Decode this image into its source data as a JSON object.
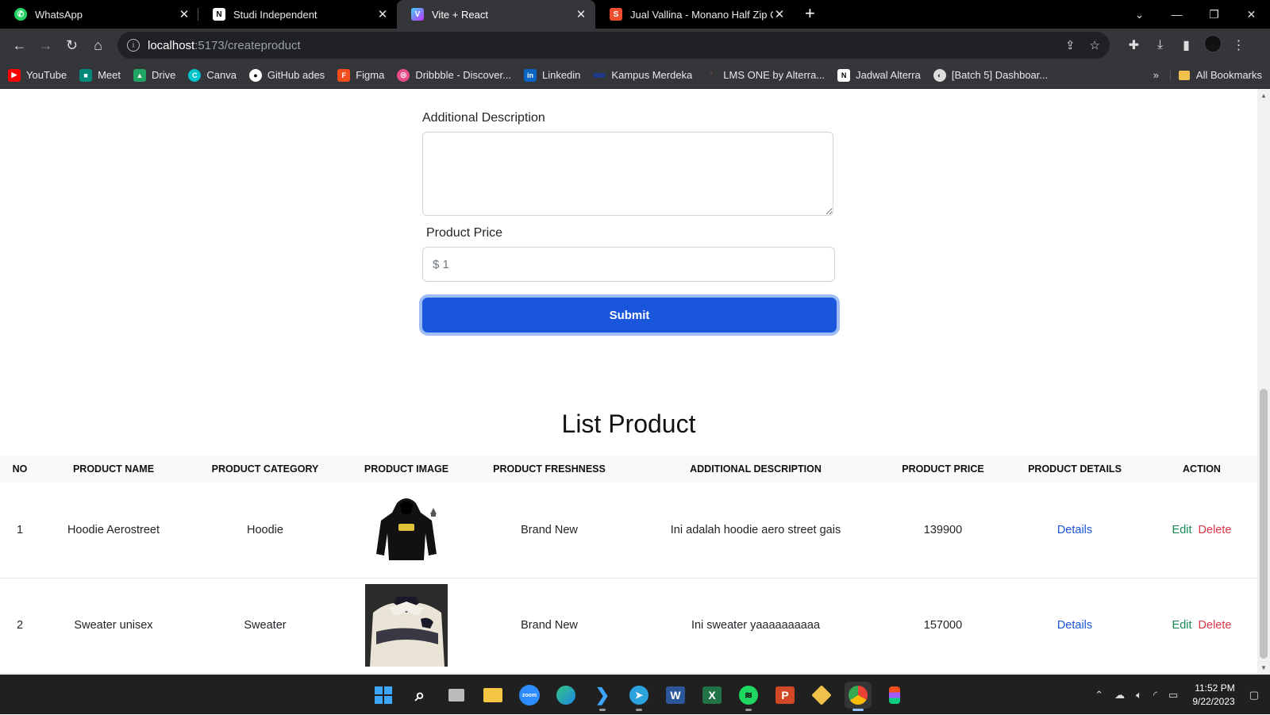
{
  "tabs": [
    {
      "title": "WhatsApp",
      "icon": "whatsapp-icon",
      "color": "#25d366",
      "active": false
    },
    {
      "title": "Studi Independent",
      "icon": "notion-icon",
      "color": "#ffffff",
      "active": false
    },
    {
      "title": "Vite + React",
      "icon": "vite-icon",
      "color": "#a259ff",
      "active": true
    },
    {
      "title": "Jual Vallina - Monano Half Zip C",
      "icon": "shopee-icon",
      "color": "#ee4d2d",
      "active": false
    }
  ],
  "address": {
    "host": "localhost",
    "path": ":5173/createproduct"
  },
  "bookmarks": [
    {
      "label": "YouTube",
      "icon": "youtube-icon",
      "color": "#ff0000"
    },
    {
      "label": "Meet",
      "icon": "meet-icon",
      "color": "#00897b"
    },
    {
      "label": "Drive",
      "icon": "drive-icon",
      "color": "#1fa463"
    },
    {
      "label": "Canva",
      "icon": "canva-icon",
      "color": "#00c4cc"
    },
    {
      "label": "GitHub ades",
      "icon": "github-icon",
      "color": "#333333"
    },
    {
      "label": "Figma",
      "icon": "figma-icon",
      "color": "#f24e1e"
    },
    {
      "label": "Dribbble - Discover...",
      "icon": "dribbble-icon",
      "color": "#ea4c89"
    },
    {
      "label": "Linkedin",
      "icon": "linkedin-icon",
      "color": "#0a66c2"
    },
    {
      "label": "Kampus Merdeka",
      "icon": "kampus-merdeka-icon",
      "color": "#1e3a8a"
    },
    {
      "label": "LMS ONE by Alterra...",
      "icon": "alterra-icon",
      "color": "#f97316"
    },
    {
      "label": "Jadwal Alterra",
      "icon": "notion-icon",
      "color": "#ffffff"
    },
    {
      "label": "[Batch 5] Dashboar...",
      "icon": "globe-icon",
      "color": "#dddddd"
    }
  ],
  "all_bookmarks": "All Bookmarks",
  "form": {
    "description_label": "Additional Description",
    "description_value": "",
    "price_label": "Product Price",
    "price_placeholder": "$ 1",
    "submit_label": "Submit"
  },
  "list_title": "List Product",
  "table": {
    "headers": [
      "NO",
      "PRODUCT NAME",
      "PRODUCT CATEGORY",
      "PRODUCT IMAGE",
      "PRODUCT FRESHNESS",
      "ADDITIONAL DESCRIPTION",
      "PRODUCT PRICE",
      "PRODUCT DETAILS",
      "ACTION"
    ],
    "rows": [
      {
        "no": "1",
        "name": "Hoodie Aerostreet",
        "category": "Hoodie",
        "image": "hoodie-image",
        "freshness": "Brand New",
        "description": "Ini adalah hoodie aero street gais",
        "price": "139900",
        "details": "Details",
        "edit": "Edit",
        "delete": "Delete"
      },
      {
        "no": "2",
        "name": "Sweater unisex",
        "category": "Sweater",
        "image": "sweater-image",
        "freshness": "Brand New",
        "description": "Ini sweater yaaaaaaaaaa",
        "price": "157000",
        "details": "Details",
        "edit": "Edit",
        "delete": "Delete"
      }
    ]
  },
  "taskbar": {
    "apps": [
      "windows-start-icon",
      "search-icon",
      "task-view-icon",
      "file-explorer-icon",
      "zoom-icon",
      "edge-icon",
      "vscode-icon",
      "telegram-icon",
      "word-icon",
      "excel-icon",
      "spotify-icon",
      "powerpoint-icon",
      "git-icon",
      "chrome-icon",
      "figma-icon"
    ],
    "time": "11:52 PM",
    "date": "9/22/2023"
  },
  "colors": {
    "primary": "#1a56db",
    "edit": "#198754",
    "delete": "#dc3545"
  }
}
